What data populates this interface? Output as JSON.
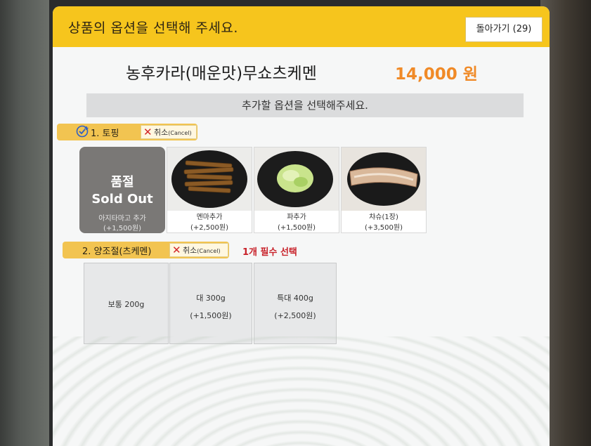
{
  "header": {
    "title": "상품의 옵션을 선택해 주세요.",
    "back_label": "돌아가기 (29)"
  },
  "product": {
    "name": "농후카라(매운맛)무쇼츠케멘",
    "price": "14,000 원"
  },
  "instruction": "추가할 옵션을 선택해주세요.",
  "section1": {
    "label": "1. 토핑",
    "cancel_label": "취소",
    "cancel_sub": "(Cancel)",
    "icon": "check-plus-icon",
    "items": [
      {
        "name": "아지타마고 추가",
        "price": "(+1,500원)",
        "sold_out": true,
        "sold_out_ko": "품절",
        "sold_out_en": "Sold Out"
      },
      {
        "name": "멘마추가",
        "price": "(+2,500원)",
        "sold_out": false
      },
      {
        "name": "파추가",
        "price": "(+1,500원)",
        "sold_out": false
      },
      {
        "name": "챠슈(1장)",
        "price": "(+3,500원)",
        "sold_out": false
      }
    ]
  },
  "section2": {
    "label": "2. 양조절(츠케멘)",
    "cancel_label": "취소",
    "cancel_sub": "(Cancel)",
    "required_note": "1개 필수 선택",
    "options": [
      {
        "line1": "보통 200g",
        "line2": ""
      },
      {
        "line1": "대 300g",
        "line2": "(+1,500원)"
      },
      {
        "line1": "특대 400g",
        "line2": "(+2,500원)"
      }
    ]
  },
  "colors": {
    "header": "#f6c51d",
    "price": "#f08a27",
    "section_bar": "#f2c451",
    "cancel_x": "#d1262a",
    "required": "#c8222a"
  }
}
